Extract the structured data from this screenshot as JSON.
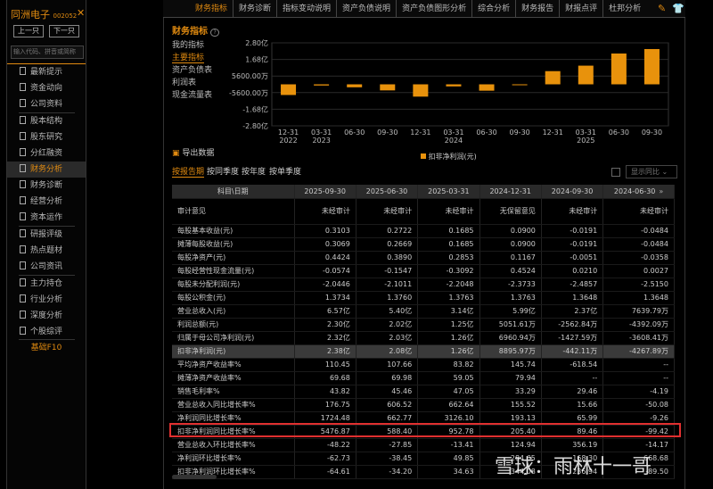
{
  "sidebar": {
    "stock_name": "同洲电子",
    "stock_code": "002052",
    "prev": "上一只",
    "next": "下一只",
    "search_placeholder": "输入代码、拼音或简称",
    "items": [
      "最新提示",
      "资金动向",
      "公司资料",
      "股本结构",
      "股东研究",
      "分红融资",
      "财务分析",
      "财务诊断",
      "经营分析",
      "资本运作",
      "研报评级",
      "热点题材",
      "公司资讯",
      "主力持仓",
      "行业分析",
      "深度分析",
      "个股综评"
    ],
    "footer": "基础F10"
  },
  "tabs": [
    "财务指标",
    "财务诊断",
    "指标变动说明",
    "资产负债说明",
    "资产负债图形分析",
    "综合分析",
    "财务报告",
    "财报点评",
    "杜邦分析"
  ],
  "section_title": "财务指标",
  "help": "?",
  "subnav": [
    "我的指标",
    "主要指标",
    "资产负债表",
    "利润表",
    "现金流量表"
  ],
  "export": "导出数据",
  "period_tabs": [
    "按报告期",
    "按同季度",
    "按年度",
    "按单季度"
  ],
  "show_yoy": "显示同比",
  "chart_data": {
    "type": "bar",
    "legend": "扣非净利润(元)",
    "unit": "亿",
    "categories": [
      [
        "12-31",
        "2022"
      ],
      [
        "03-31",
        "2023"
      ],
      [
        "06-30",
        ""
      ],
      [
        "09-30",
        ""
      ],
      [
        "12-31",
        ""
      ],
      [
        "03-31",
        "2024"
      ],
      [
        "06-30",
        ""
      ],
      [
        "09-30",
        ""
      ],
      [
        "12-31",
        ""
      ],
      [
        "03-31",
        "2025"
      ],
      [
        "06-30",
        ""
      ],
      [
        "09-30",
        ""
      ]
    ],
    "values": [
      -0.72,
      -0.08,
      -0.2,
      -0.41,
      -0.83,
      -0.14,
      -0.43,
      -0.04,
      0.89,
      1.26,
      2.08,
      2.38
    ],
    "ylim": [
      -2.8,
      2.8
    ],
    "yticks": [
      "2.80亿",
      "1.68亿",
      "5600.00万",
      "-5600.00万",
      "-1.68亿",
      "-2.80亿"
    ],
    "color": "#e8920c"
  },
  "table": {
    "header": [
      "科目\\日期",
      "2025-09-30",
      "2025-06-30",
      "2025-03-31",
      "2024-12-31",
      "2024-09-30",
      "2024-06-30"
    ],
    "more": "»",
    "rows": [
      [
        "审计意见",
        "未经审计",
        "未经审计",
        "未经审计",
        "无保留意见",
        "未经审计",
        "未经审计"
      ],
      [
        "每股基本收益(元)",
        "0.3103",
        "0.2722",
        "0.1685",
        "0.0900",
        "-0.0191",
        "-0.0484"
      ],
      [
        "摊薄每股收益(元)",
        "0.3069",
        "0.2669",
        "0.1685",
        "0.0900",
        "-0.0191",
        "-0.0484"
      ],
      [
        "每股净资产(元)",
        "0.4424",
        "0.3890",
        "0.2853",
        "0.1167",
        "-0.0051",
        "-0.0358"
      ],
      [
        "每股经营性现金流量(元)",
        "-0.0574",
        "-0.1547",
        "-0.3092",
        "0.4524",
        "0.0210",
        "0.0027"
      ],
      [
        "每股未分配利润(元)",
        "-2.0446",
        "-2.1011",
        "-2.2048",
        "-2.3733",
        "-2.4857",
        "-2.5150"
      ],
      [
        "每股公积金(元)",
        "1.3734",
        "1.3760",
        "1.3763",
        "1.3763",
        "1.3648",
        "1.3648"
      ],
      [
        "营业总收入(元)",
        "6.57亿",
        "5.40亿",
        "3.14亿",
        "5.99亿",
        "2.37亿",
        "7639.79万"
      ],
      [
        "利润总额(元)",
        "2.30亿",
        "2.02亿",
        "1.25亿",
        "5051.61万",
        "-2562.84万",
        "-4392.09万"
      ],
      [
        "归属于母公司净利润(元)",
        "2.32亿",
        "2.03亿",
        "1.26亿",
        "6960.94万",
        "-1427.59万",
        "-3608.41万"
      ],
      [
        "扣非净利润(元)",
        "2.38亿",
        "2.08亿",
        "1.26亿",
        "8895.97万",
        "-442.11万",
        "-4267.89万"
      ],
      [
        "平均净资产收益率%",
        "110.45",
        "107.66",
        "83.82",
        "145.74",
        "-618.54",
        "--"
      ],
      [
        "摊薄净资产收益率%",
        "69.68",
        "69.98",
        "59.05",
        "79.94",
        "--",
        "--"
      ],
      [
        "销售毛利率%",
        "43.82",
        "45.46",
        "47.05",
        "33.29",
        "29.46",
        "-4.19"
      ],
      [
        "营业总收入同比增长率%",
        "176.75",
        "606.52",
        "662.64",
        "155.52",
        "15.66",
        "-50.08"
      ],
      [
        "净利润同比增长率%",
        "1724.48",
        "662.77",
        "3126.10",
        "193.13",
        "65.99",
        "-9.26"
      ],
      [
        "扣非净利润同比增长率%",
        "5476.87",
        "588.40",
        "952.78",
        "205.40",
        "89.46",
        "-99.42"
      ],
      [
        "营业总收入环比增长率%",
        "-48.22",
        "-27.85",
        "-13.41",
        "124.94",
        "356.19",
        "-14.17"
      ],
      [
        "净利润环比增长率%",
        "-62.73",
        "-38.45",
        "49.85",
        "284.65",
        "168.30",
        "668.68"
      ],
      [
        "扣非净利润环比增长率%",
        "-64.61",
        "-34.20",
        "34.63",
        "344.08",
        "236.94",
        "-89.50"
      ]
    ]
  },
  "watermark": "雪球：雨林十一哥"
}
